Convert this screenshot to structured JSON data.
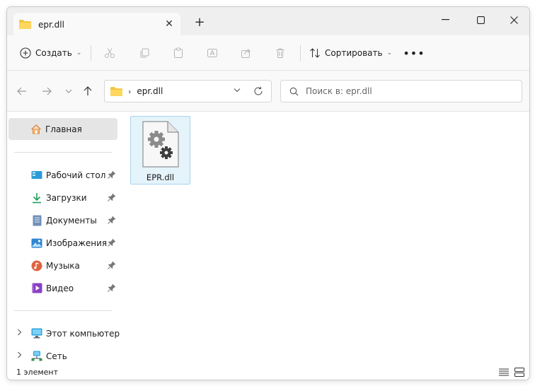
{
  "tab": {
    "title": "epr.dll"
  },
  "toolbar": {
    "create_label": "Создать",
    "sort_label": "Сортировать",
    "more_label": "•••"
  },
  "address": {
    "path_segment": "epr.dll"
  },
  "search": {
    "placeholder": "Поиск в: epr.dll"
  },
  "sidebar": {
    "home": "Главная",
    "quick_access": [
      {
        "label": "Рабочий стол"
      },
      {
        "label": "Загрузки"
      },
      {
        "label": "Документы"
      },
      {
        "label": "Изображения"
      },
      {
        "label": "Музыка"
      },
      {
        "label": "Видео"
      }
    ],
    "this_pc": "Этот компьютер",
    "network": "Сеть"
  },
  "files": [
    {
      "name": "EPR.dll"
    }
  ],
  "status": {
    "count": "1 элемент"
  },
  "colors": {
    "folder": "#f4c542",
    "selection_bg": "#e5f3fb",
    "selection_border": "#a8d3f0",
    "sidebar_active": "#e5e5e5"
  }
}
